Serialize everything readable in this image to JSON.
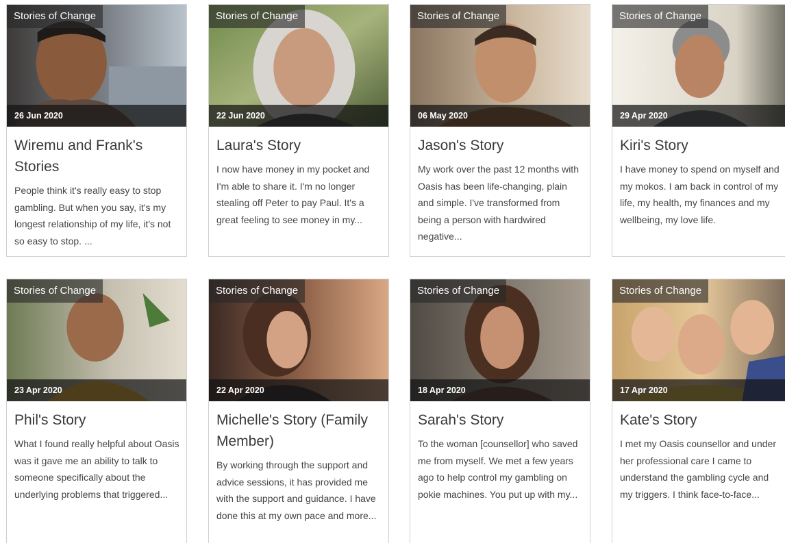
{
  "category_label": "Stories of Change",
  "stories": [
    {
      "date": "26 Jun 2020",
      "title": "Wiremu and Frank's Stories",
      "excerpt": "People think it's really easy to stop gambling. But when you say, it's my longest relationship of my life, it's not so easy to stop.  ..."
    },
    {
      "date": "22 Jun 2020",
      "title": "Laura's Story",
      "excerpt": "I now have money in my pocket and I'm able to share it. I'm no longer stealing off Peter to pay Paul. It's a great feeling to see money in my..."
    },
    {
      "date": "06 May 2020",
      "title": "Jason's Story",
      "excerpt": "My work over the past 12 months with Oasis has been life-changing, plain and simple. I've transformed from being a person with hardwired negative..."
    },
    {
      "date": "29 Apr 2020",
      "title": "Kiri's Story",
      "excerpt": "I have money to spend on myself and my mokos.  I am back in control of my life, my health, my finances and my wellbeing, my love life."
    },
    {
      "date": "23 Apr 2020",
      "title": "Phil's Story",
      "excerpt": "What I found really helpful about Oasis was it gave me an ability to talk to someone specifically about the underlying problems that triggered..."
    },
    {
      "date": "22 Apr 2020",
      "title": "Michelle's Story (Family Member)",
      "excerpt": "By working through the support and advice sessions, it has provided me with the support and guidance. I have done this at my own pace and more..."
    },
    {
      "date": "18 Apr 2020",
      "title": "Sarah's Story",
      "excerpt": "To the woman [counsellor] who saved me from myself. We met a few years ago to help control my gambling on pokie machines. You put up with my..."
    },
    {
      "date": "17 Apr 2020",
      "title": "Kate's Story",
      "excerpt": "I met my Oasis counsellor and under her professional care I came to understand the gambling cycle and my triggers. I think face-to-face..."
    }
  ]
}
